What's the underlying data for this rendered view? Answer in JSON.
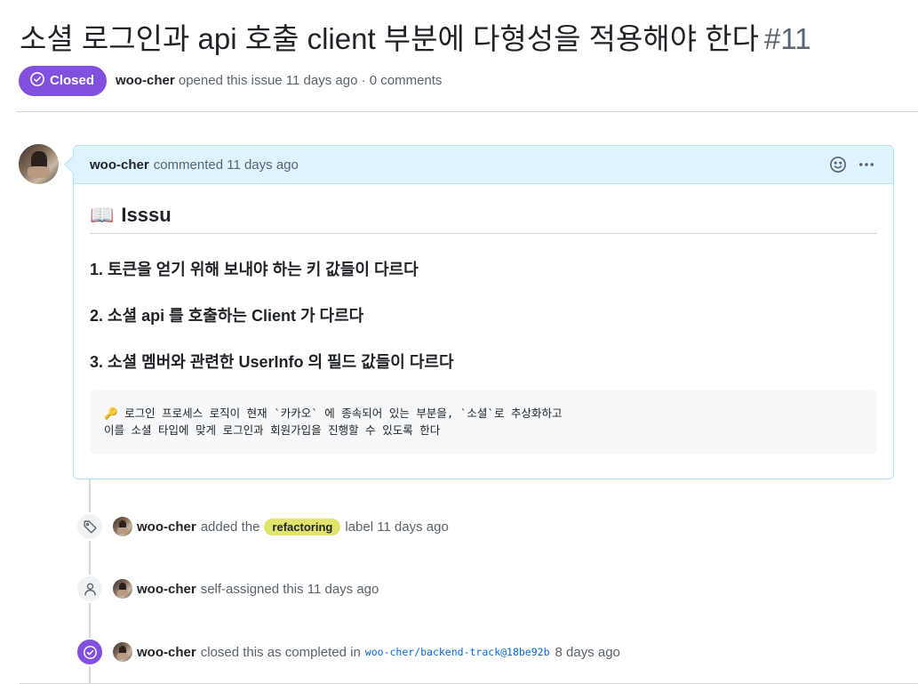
{
  "issue": {
    "title": "소셜 로그인과 api 호출 client 부분에 다형성을 적용해야 한다",
    "number": "#11",
    "state": "Closed",
    "author": "woo-cher",
    "opened_text": "opened this issue 11 days ago · 0 comments"
  },
  "comment": {
    "author": "woo-cher",
    "time_text": "commented 11 days ago",
    "heading_icon": "📖",
    "heading": "Isssu",
    "items": [
      "1. 토큰을 얻기 위해 보내야 하는 키 값들이 다르다",
      "2. 소셜 api 를 호출하는 Client 가 다르다",
      "3. 소셜 멤버와 관련한 UserInfo 의 필드 값들이 다르다"
    ],
    "code_lines": [
      "🔑 로그인 프로세스 로직이 현재 `카카오` 에 종속되어 있는 부분을, `소셜`로 추상화하고",
      "이를 소셜 타입에 맞게 로그인과 회원가입을 진행할 수 있도록 한다"
    ]
  },
  "timeline": [
    {
      "user": "woo-cher",
      "before": "added the",
      "label": "refactoring",
      "after": "label 11 days ago",
      "icon": "tag-icon"
    },
    {
      "user": "woo-cher",
      "text": "self-assigned this 11 days ago",
      "icon": "person-icon"
    },
    {
      "user": "woo-cher",
      "before": "closed this as completed in",
      "commit": "woo-cher/backend-track@18be92b",
      "after": "8 days ago",
      "icon": "check-circle-icon"
    }
  ],
  "colors": {
    "closed_badge": "#8250df",
    "comment_header": "#ddf4ff",
    "label_refactoring": "#e1e36b",
    "link": "#0969da"
  }
}
